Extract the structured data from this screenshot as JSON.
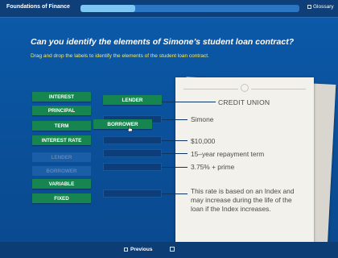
{
  "header": {
    "course_title": "Foundations of Finance",
    "progress_fraction": 0.25,
    "glossary_label": "Glossary"
  },
  "activity": {
    "question": "Can you identify the elements of Simone’s student loan contract?",
    "instruction": "Drag and drop the labels to identify the elements of the student loan contract."
  },
  "chips": [
    {
      "label": "INTEREST",
      "state": "available"
    },
    {
      "label": "PRINCIPAL",
      "state": "available"
    },
    {
      "label": "TERM",
      "state": "available"
    },
    {
      "label": "INTEREST RATE",
      "state": "available"
    },
    {
      "label": "LENDER",
      "state": "placed"
    },
    {
      "label": "BORROWER",
      "state": "dragging"
    },
    {
      "label": "VARIABLE",
      "state": "available"
    },
    {
      "label": "FIXED",
      "state": "available"
    }
  ],
  "contract": {
    "lender": "CREDIT UNION",
    "borrower": "Simone",
    "amount": "$10,000",
    "term": "15–year repayment term",
    "rate": "3.75% + prime",
    "note": "This rate is based on an Index and may increase during the life of the loan if the Index increases."
  },
  "footer": {
    "previous_label": "Previous"
  },
  "colors": {
    "background": "#0b4f96",
    "chip": "#16854f",
    "instruction": "#f5e96a",
    "paper": "#f3f1eb"
  },
  "icons": [
    "glossary-box-icon",
    "previous-box-icon",
    "next-box-icon",
    "hand-cursor-icon"
  ]
}
